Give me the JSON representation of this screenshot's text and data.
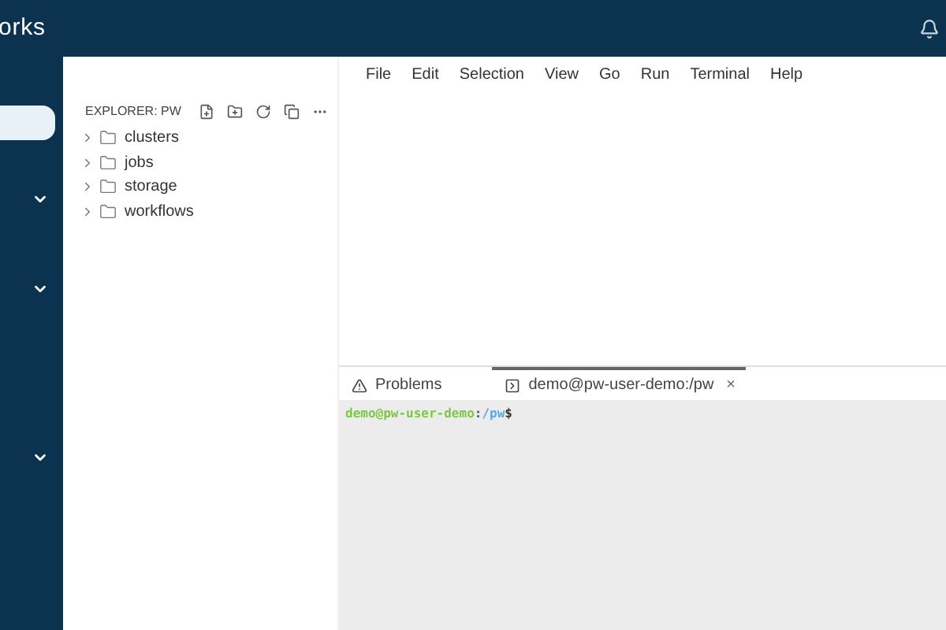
{
  "header": {
    "logo_text": "orks"
  },
  "sidebar": {
    "items": [
      {
        "kind": "pill",
        "selected": true
      },
      {
        "kind": "chevron",
        "expanded": false
      },
      {
        "kind": "chevron",
        "expanded": false
      },
      {
        "kind": "chevron",
        "expanded": false
      }
    ]
  },
  "menu": [
    "File",
    "Edit",
    "Selection",
    "View",
    "Go",
    "Run",
    "Terminal",
    "Help"
  ],
  "explorer": {
    "title": "EXPLORER: PW",
    "folders": [
      {
        "name": "clusters",
        "expanded": false
      },
      {
        "name": "jobs",
        "expanded": false
      },
      {
        "name": "storage",
        "expanded": false
      },
      {
        "name": "workflows",
        "expanded": false
      }
    ]
  },
  "panel": {
    "tabs": [
      {
        "kind": "problems",
        "label": "Problems",
        "selected": false
      },
      {
        "kind": "terminal",
        "label": "demo@pw-user-demo:/pw",
        "selected": true,
        "close": "×"
      }
    ],
    "prompt": {
      "user": "demo@pw-user-demo",
      "sep": ":",
      "path": "/pw",
      "end": "$"
    }
  }
}
